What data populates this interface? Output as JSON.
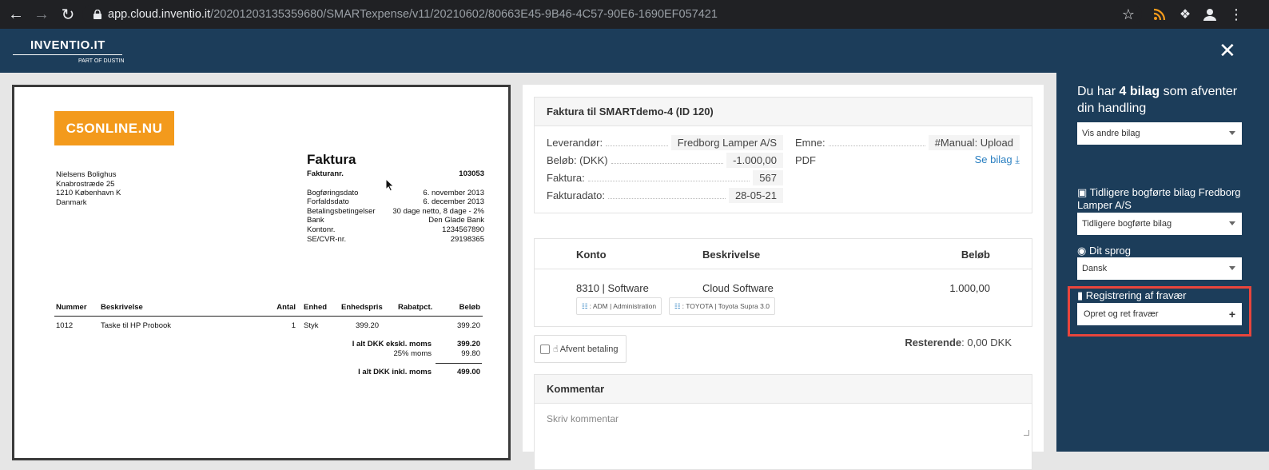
{
  "browser": {
    "url_host": "app.cloud.inventio.it",
    "url_path": "/20201203135359680/SMARTexpense/v11/20210602/80663E45-9B46-4C57-90E6-1690EF057421",
    "icons": [
      "back-icon",
      "forward-icon",
      "reload-icon",
      "lock-icon",
      "star-icon",
      "rss-icon",
      "puzzle-icon",
      "profile-icon",
      "menu-icon"
    ]
  },
  "app": {
    "logo_title": "INVENTIO.IT",
    "logo_sub": "PART OF DUSTIN"
  },
  "invoice_doc": {
    "brand": "C5ONLINE.NU",
    "title": "Faktura",
    "address": [
      "Nielsens Bolighus",
      "Knabrostræde 25",
      "1210 København K",
      "Danmark"
    ],
    "meta": [
      {
        "label": "Fakturanr.",
        "value": "103053"
      },
      {
        "label": "Bogføringsdato",
        "value": "6. november 2013"
      },
      {
        "label": "Forfaldsdato",
        "value": "6. december 2013"
      },
      {
        "label": "Betalingsbetingelser",
        "value": "30 dage netto, 8 dage - 2%"
      },
      {
        "label": "Bank",
        "value": "Den Glade Bank"
      },
      {
        "label": "Kontonr.",
        "value": "1234567890"
      },
      {
        "label": "SE/CVR-nr.",
        "value": "29198365"
      }
    ],
    "columns": [
      "Nummer",
      "Beskrivelse",
      "Antal",
      "Enhed",
      "Enhedspris",
      "Rabatpct.",
      "Beløb"
    ],
    "row": {
      "nummer": "1012",
      "beskrivelse": "Taske til HP Probook",
      "antal": "1",
      "enhed": "Styk",
      "enhedspris": "399.20",
      "belob": "399.20"
    },
    "totals": [
      {
        "label": "I alt DKK ekskl. moms",
        "value": "399.20"
      },
      {
        "label": "25% moms",
        "value": "99.80"
      },
      {
        "label": "I alt DKK inkl. moms",
        "value": "499.00"
      }
    ]
  },
  "details": {
    "header": "Faktura til SMARTdemo-4 (ID 120)",
    "left": [
      {
        "label": "Leverandør:",
        "value": "Fredborg Lamper A/S"
      },
      {
        "label": "Beløb: (DKK)",
        "value": "-1.000,00"
      },
      {
        "label": "Faktura:",
        "value": "567"
      },
      {
        "label": "Fakturadato:",
        "value": "28-05-21"
      }
    ],
    "right": [
      {
        "label": "Emne:",
        "value": "#Manual: Upload"
      },
      {
        "label": "PDF",
        "value": "Se bilag"
      }
    ]
  },
  "lines": {
    "headers": [
      "Konto",
      "Beskrivelse",
      "Beløb"
    ],
    "konto": "8310 | Software",
    "beskrivelse": "Cloud Software",
    "belob": "1.000,00",
    "tags": [
      ": ADM | Administration",
      ": TOYOTA | Toyota Supra 3.0"
    ]
  },
  "afvent": "Afvent betaling",
  "resterende_label": "Resterende",
  "resterende_value": ": 0,00 DKK",
  "comment": {
    "header": "Kommentar",
    "placeholder": "Skriv kommentar"
  },
  "sidebar": {
    "intro_pre": "Du har ",
    "intro_bold": "4 bilag",
    "intro_post": " som afventer din handling",
    "select1": "Vis andre bilag",
    "prev_header": "Tidligere bogførte bilag Fredborg Lamper A/S",
    "select2": "Tidligere bogførte bilag",
    "lang_header": "Dit sprog",
    "select3": "Dansk",
    "absence_header": "Registrering af fravær",
    "absence_button": "Opret og ret fravær",
    "highlight_color": "#e8453c"
  }
}
